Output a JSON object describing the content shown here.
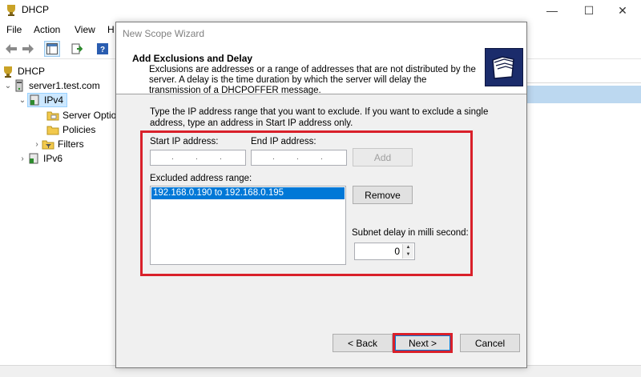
{
  "window": {
    "title": "DHCP",
    "controls": {
      "minimize": "—",
      "maximize": "☐",
      "close": "✕"
    }
  },
  "menu": {
    "items": [
      "File",
      "Action",
      "View",
      "H"
    ]
  },
  "tree": {
    "root": "DHCP",
    "server": "server1.test.com",
    "ipv4": "IPv4",
    "server_options": "Server Optio",
    "policies": "Policies",
    "filters": "Filters",
    "ipv6": "IPv6"
  },
  "wizard": {
    "title": "New Scope Wizard",
    "heading": "Add Exclusions and Delay",
    "description": "Exclusions are addresses or a range of addresses that are not distributed by the server. A delay is the time duration by which the server will delay the transmission of a DHCPOFFER message.",
    "instructions": "Type the IP address range that you want to exclude. If you want to exclude a single address, type an address in Start IP address only.",
    "start_ip_label": "Start IP address:",
    "end_ip_label": "End IP address:",
    "add_button": "Add",
    "excluded_label": "Excluded address range:",
    "excluded_items": [
      "192.168.0.190 to 192.168.0.195"
    ],
    "remove_button": "Remove",
    "delay_label": "Subnet delay in milli second:",
    "delay_value": "0",
    "back_button": "< Back",
    "next_button": "Next >",
    "cancel_button": "Cancel"
  },
  "colors": {
    "highlight_red": "#d9202a",
    "selection_blue": "#0078d7",
    "tree_selection": "#cce8ff"
  }
}
